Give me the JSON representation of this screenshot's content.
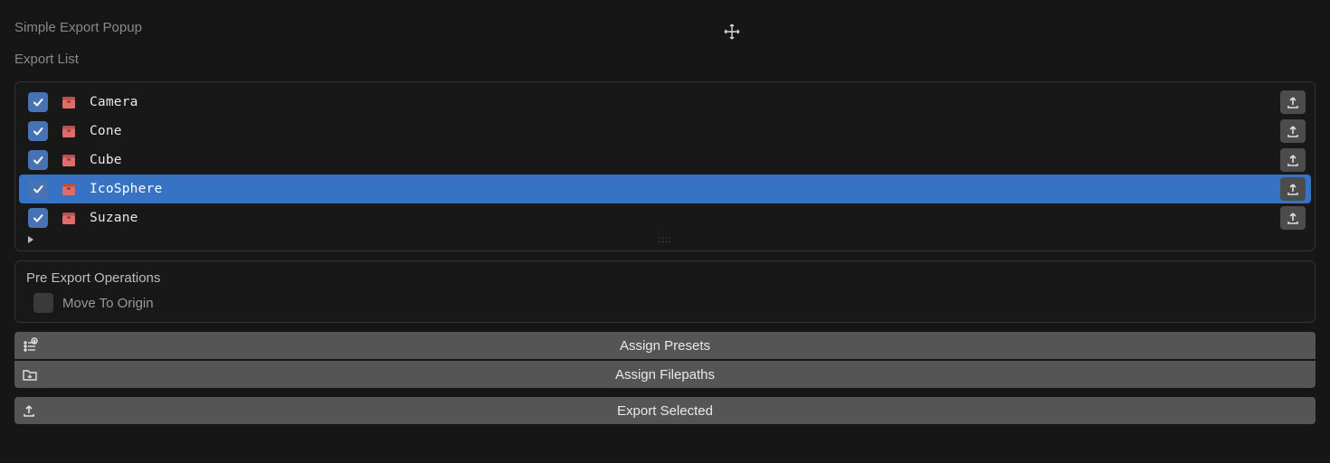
{
  "popup_title": "Simple Export Popup",
  "section_label": "Export List",
  "objects": [
    {
      "name": "Camera",
      "checked": true,
      "selected": false
    },
    {
      "name": "Cone",
      "checked": true,
      "selected": false
    },
    {
      "name": "Cube",
      "checked": true,
      "selected": false
    },
    {
      "name": "IcoSphere",
      "checked": true,
      "selected": true
    },
    {
      "name": "Suzane",
      "checked": true,
      "selected": false
    }
  ],
  "pre_export": {
    "title": "Pre Export Operations",
    "move_to_origin": {
      "label": "Move To Origin",
      "checked": false
    }
  },
  "buttons": {
    "assign_presets": "Assign Presets",
    "assign_filepaths": "Assign Filepaths",
    "export_selected": "Export Selected"
  },
  "icons": {
    "object_box": "object-box-icon",
    "export_arrow": "export-upload-icon",
    "list_add": "list-add-icon",
    "folder_in": "folder-import-icon"
  }
}
